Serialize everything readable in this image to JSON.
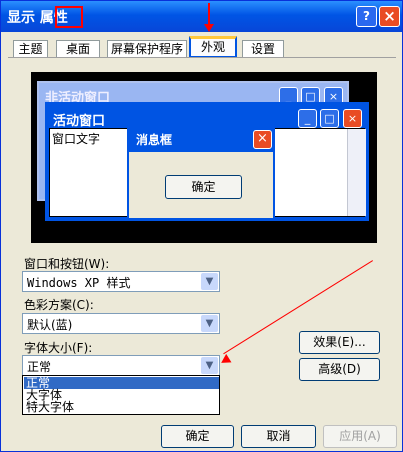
{
  "window": {
    "title": "显示 属性",
    "help": "?",
    "close": "×"
  },
  "tabs": [
    "主题",
    "桌面",
    "屏幕保护程序",
    "外观",
    "设置"
  ],
  "preview": {
    "inactive_title": "非活动窗口",
    "active_title": "活动窗口",
    "window_text": "窗口文字",
    "message_title": "消息框",
    "ok": "确定",
    "minimize": "_",
    "maximize": "□",
    "close": "×"
  },
  "controls": {
    "windows_buttons_label": "窗口和按钮(W):",
    "windows_buttons_value": "Windows XP 样式",
    "color_scheme_label": "色彩方案(C):",
    "color_scheme_value": "默认(蓝)",
    "font_size_label": "字体大小(F):",
    "font_size_value": "正常",
    "font_size_options": [
      "正常",
      "大字体",
      "特大字体"
    ],
    "effects": "效果(E)...",
    "advanced": "高级(D)"
  },
  "footer": {
    "ok": "确定",
    "cancel": "取消",
    "apply": "应用(A)"
  }
}
